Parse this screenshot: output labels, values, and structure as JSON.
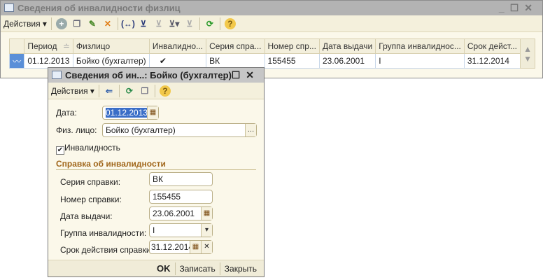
{
  "main": {
    "title": "Сведения об инвалидности физлиц",
    "actions": "Действия",
    "toolbar_icons": [
      "add-icon",
      "copy-icon",
      "edit-icon",
      "delete-icon",
      "interval-icon",
      "filter-settings-icon",
      "filter-icon",
      "filter-list-icon",
      "clear-filter-icon",
      "refresh-icon",
      "help-icon"
    ],
    "columns": [
      "Период",
      "Физлицо",
      "Инвалидно...",
      "Серия спра...",
      "Номер спр...",
      "Дата выдачи",
      "Группа инвалиднос...",
      "Срок дейст..."
    ],
    "rows": [
      {
        "period": "01.12.2013",
        "person": "Бойко (бухгалтер)",
        "disabled": "✔",
        "series": "ВК",
        "number": "155455",
        "issue_date": "23.06.2001",
        "group": "I",
        "valid_until": "31.12.2014"
      }
    ]
  },
  "dialog": {
    "title": "Сведения об ин...: Бойко (бухгалтер)",
    "actions": "Действия",
    "date_label": "Дата:",
    "date_value": "01.12.2013",
    "person_label": "Физ. лицо:",
    "person_value": "Бойко (бухгалтер)",
    "disability_label": "Инвалидность",
    "disability_checked": true,
    "section_title": "Справка об инвалидности",
    "series_label": "Серия справки:",
    "series_value": "ВК",
    "number_label": "Номер справки:",
    "number_value": "155455",
    "issue_label": "Дата выдачи:",
    "issue_value": "23.06.2001",
    "group_label": "Группа инвалидности:",
    "group_value": "I",
    "valid_label": "Срок действия справки:",
    "valid_value": "31.12.2014",
    "ok": "OK",
    "save": "Записать",
    "close": "Закрыть"
  },
  "colors": {
    "accent_section": "#a0661a",
    "selection": "#3a6ec7"
  }
}
